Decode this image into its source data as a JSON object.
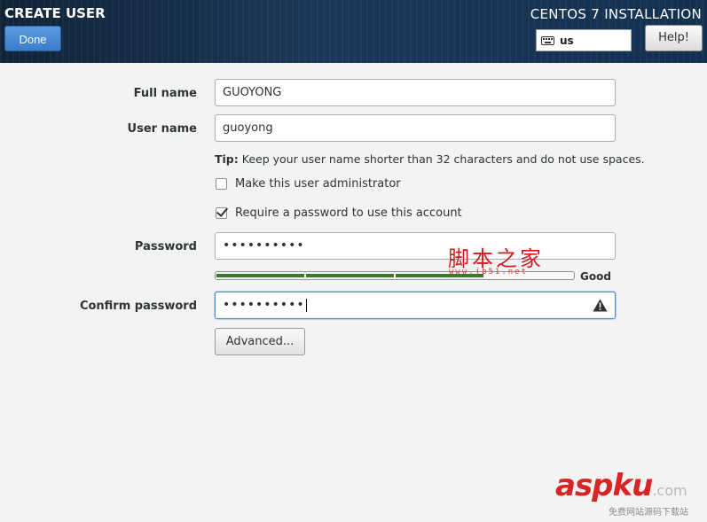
{
  "header": {
    "screen_title": "CREATE USER",
    "done_label": "Done",
    "install_title": "CENTOS 7 INSTALLATION",
    "keyboard_layout": "us",
    "help_label": "Help!"
  },
  "form": {
    "full_name_label": "Full name",
    "full_name_value": "GUOYONG",
    "user_name_label": "User name",
    "user_name_value": "guoyong",
    "tip_prefix": "Tip:",
    "tip_text": "Keep your user name shorter than 32 characters and do not use spaces.",
    "admin_checkbox_label": "Make this user administrator",
    "admin_checked": false,
    "require_password_label": "Require a password to use this account",
    "require_password_checked": true,
    "password_label": "Password",
    "password_value": "••••••••••",
    "strength_level": 0.75,
    "strength_label": "Good",
    "confirm_label": "Confirm password",
    "confirm_value": "••••••••••",
    "advanced_label": "Advanced..."
  },
  "watermarks": {
    "jb51_text": "脚本之家",
    "jb51_url": "www.jb51.net",
    "aspku_text": "aspku",
    "aspku_com": ".com",
    "aspku_sub": "免费网站源码下载站"
  },
  "colors": {
    "header_bg": "#1b3757",
    "accent_blue": "#3a7cc9",
    "strength_green": "#3b7a27",
    "watermark_red": "#d21c1c"
  }
}
